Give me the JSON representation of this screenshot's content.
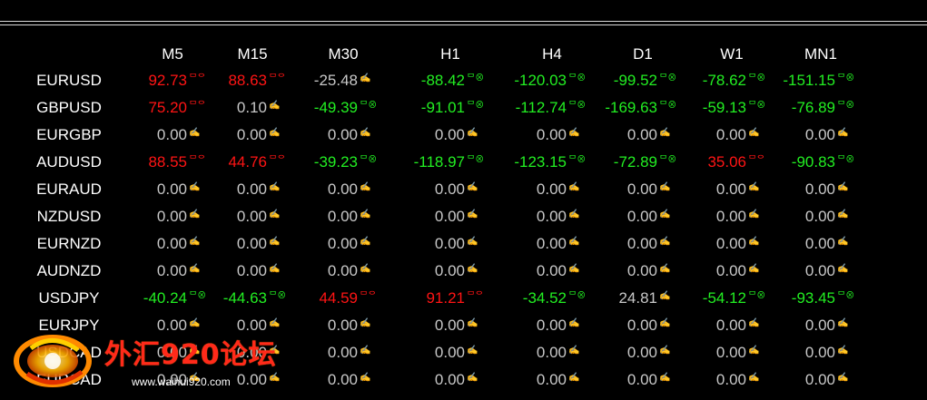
{
  "timeframes": [
    "M5",
    "M15",
    "M30",
    "H1",
    "H4",
    "D1",
    "W1",
    "MN1"
  ],
  "colors": {
    "positive": "#ff1414",
    "negative": "#22ee22",
    "neutral": "#c8c8c8",
    "background": "#000000"
  },
  "rows": [
    {
      "symbol": "EURUSD",
      "cells": [
        {
          "value": "92.73",
          "trend": "pos",
          "icon": "ᄆᄋ"
        },
        {
          "value": "88.63",
          "trend": "pos",
          "icon": "ᄆᄋ"
        },
        {
          "value": "-25.48",
          "trend": "neu",
          "icon": "✍"
        },
        {
          "value": "-88.42",
          "trend": "neg",
          "icon": "ᄆ⊗"
        },
        {
          "value": "-120.03",
          "trend": "neg",
          "icon": "ᄆ⊗"
        },
        {
          "value": "-99.52",
          "trend": "neg",
          "icon": "ᄆ⊗"
        },
        {
          "value": "-78.62",
          "trend": "neg",
          "icon": "ᄆ⊗"
        },
        {
          "value": "-151.15",
          "trend": "neg",
          "icon": "ᄆ⊗"
        }
      ]
    },
    {
      "symbol": "GBPUSD",
      "cells": [
        {
          "value": "75.20",
          "trend": "pos",
          "icon": "ᄆᄋ"
        },
        {
          "value": "0.10",
          "trend": "neu",
          "icon": "✍"
        },
        {
          "value": "-49.39",
          "trend": "neg",
          "icon": "ᄆ⊗"
        },
        {
          "value": "-91.01",
          "trend": "neg",
          "icon": "ᄆ⊗"
        },
        {
          "value": "-112.74",
          "trend": "neg",
          "icon": "ᄆ⊗"
        },
        {
          "value": "-169.63",
          "trend": "neg",
          "icon": "ᄆ⊗"
        },
        {
          "value": "-59.13",
          "trend": "neg",
          "icon": "ᄆ⊗"
        },
        {
          "value": "-76.89",
          "trend": "neg",
          "icon": "ᄆ⊗"
        }
      ]
    },
    {
      "symbol": "EURGBP",
      "cells": [
        {
          "value": "0.00",
          "trend": "neu",
          "icon": "✍"
        },
        {
          "value": "0.00",
          "trend": "neu",
          "icon": "✍"
        },
        {
          "value": "0.00",
          "trend": "neu",
          "icon": "✍"
        },
        {
          "value": "0.00",
          "trend": "neu",
          "icon": "✍"
        },
        {
          "value": "0.00",
          "trend": "neu",
          "icon": "✍"
        },
        {
          "value": "0.00",
          "trend": "neu",
          "icon": "✍"
        },
        {
          "value": "0.00",
          "trend": "neu",
          "icon": "✍"
        },
        {
          "value": "0.00",
          "trend": "neu",
          "icon": "✍"
        }
      ]
    },
    {
      "symbol": "AUDUSD",
      "cells": [
        {
          "value": "88.55",
          "trend": "pos",
          "icon": "ᄆᄋ"
        },
        {
          "value": "44.76",
          "trend": "pos",
          "icon": "ᄆᄋ"
        },
        {
          "value": "-39.23",
          "trend": "neg",
          "icon": "ᄆ⊗"
        },
        {
          "value": "-118.97",
          "trend": "neg",
          "icon": "ᄆ⊗"
        },
        {
          "value": "-123.15",
          "trend": "neg",
          "icon": "ᄆ⊗"
        },
        {
          "value": "-72.89",
          "trend": "neg",
          "icon": "ᄆ⊗"
        },
        {
          "value": "35.06",
          "trend": "pos",
          "icon": "ᄆᄋ"
        },
        {
          "value": "-90.83",
          "trend": "neg",
          "icon": "ᄆ⊗"
        }
      ]
    },
    {
      "symbol": "EURAUD",
      "cells": [
        {
          "value": "0.00",
          "trend": "neu",
          "icon": "✍"
        },
        {
          "value": "0.00",
          "trend": "neu",
          "icon": "✍"
        },
        {
          "value": "0.00",
          "trend": "neu",
          "icon": "✍"
        },
        {
          "value": "0.00",
          "trend": "neu",
          "icon": "✍"
        },
        {
          "value": "0.00",
          "trend": "neu",
          "icon": "✍"
        },
        {
          "value": "0.00",
          "trend": "neu",
          "icon": "✍"
        },
        {
          "value": "0.00",
          "trend": "neu",
          "icon": "✍"
        },
        {
          "value": "0.00",
          "trend": "neu",
          "icon": "✍"
        }
      ]
    },
    {
      "symbol": "NZDUSD",
      "cells": [
        {
          "value": "0.00",
          "trend": "neu",
          "icon": "✍"
        },
        {
          "value": "0.00",
          "trend": "neu",
          "icon": "✍"
        },
        {
          "value": "0.00",
          "trend": "neu",
          "icon": "✍"
        },
        {
          "value": "0.00",
          "trend": "neu",
          "icon": "✍"
        },
        {
          "value": "0.00",
          "trend": "neu",
          "icon": "✍"
        },
        {
          "value": "0.00",
          "trend": "neu",
          "icon": "✍"
        },
        {
          "value": "0.00",
          "trend": "neu",
          "icon": "✍"
        },
        {
          "value": "0.00",
          "trend": "neu",
          "icon": "✍"
        }
      ]
    },
    {
      "symbol": "EURNZD",
      "cells": [
        {
          "value": "0.00",
          "trend": "neu",
          "icon": "✍"
        },
        {
          "value": "0.00",
          "trend": "neu",
          "icon": "✍"
        },
        {
          "value": "0.00",
          "trend": "neu",
          "icon": "✍"
        },
        {
          "value": "0.00",
          "trend": "neu",
          "icon": "✍"
        },
        {
          "value": "0.00",
          "trend": "neu",
          "icon": "✍"
        },
        {
          "value": "0.00",
          "trend": "neu",
          "icon": "✍"
        },
        {
          "value": "0.00",
          "trend": "neu",
          "icon": "✍"
        },
        {
          "value": "0.00",
          "trend": "neu",
          "icon": "✍"
        }
      ]
    },
    {
      "symbol": "AUDNZD",
      "cells": [
        {
          "value": "0.00",
          "trend": "neu",
          "icon": "✍"
        },
        {
          "value": "0.00",
          "trend": "neu",
          "icon": "✍"
        },
        {
          "value": "0.00",
          "trend": "neu",
          "icon": "✍"
        },
        {
          "value": "0.00",
          "trend": "neu",
          "icon": "✍"
        },
        {
          "value": "0.00",
          "trend": "neu",
          "icon": "✍"
        },
        {
          "value": "0.00",
          "trend": "neu",
          "icon": "✍"
        },
        {
          "value": "0.00",
          "trend": "neu",
          "icon": "✍"
        },
        {
          "value": "0.00",
          "trend": "neu",
          "icon": "✍"
        }
      ]
    },
    {
      "symbol": "USDJPY",
      "cells": [
        {
          "value": "-40.24",
          "trend": "neg",
          "icon": "ᄆ⊗"
        },
        {
          "value": "-44.63",
          "trend": "neg",
          "icon": "ᄆ⊗"
        },
        {
          "value": "44.59",
          "trend": "pos",
          "icon": "ᄆᄋ"
        },
        {
          "value": "91.21",
          "trend": "pos",
          "icon": "ᄆᄋ"
        },
        {
          "value": "-34.52",
          "trend": "neg",
          "icon": "ᄆ⊗"
        },
        {
          "value": "24.81",
          "trend": "neu",
          "icon": "✍"
        },
        {
          "value": "-54.12",
          "trend": "neg",
          "icon": "ᄆ⊗"
        },
        {
          "value": "-93.45",
          "trend": "neg",
          "icon": "ᄆ⊗"
        }
      ]
    },
    {
      "symbol": "EURJPY",
      "cells": [
        {
          "value": "0.00",
          "trend": "neu",
          "icon": "✍"
        },
        {
          "value": "0.00",
          "trend": "neu",
          "icon": "✍"
        },
        {
          "value": "0.00",
          "trend": "neu",
          "icon": "✍"
        },
        {
          "value": "0.00",
          "trend": "neu",
          "icon": "✍"
        },
        {
          "value": "0.00",
          "trend": "neu",
          "icon": "✍"
        },
        {
          "value": "0.00",
          "trend": "neu",
          "icon": "✍"
        },
        {
          "value": "0.00",
          "trend": "neu",
          "icon": "✍"
        },
        {
          "value": "0.00",
          "trend": "neu",
          "icon": "✍"
        }
      ]
    },
    {
      "symbol": "USDCAD",
      "cells": [
        {
          "value": "0.00",
          "trend": "neu",
          "icon": "✍"
        },
        {
          "value": "0.00",
          "trend": "neu",
          "icon": "✍"
        },
        {
          "value": "0.00",
          "trend": "neu",
          "icon": "✍"
        },
        {
          "value": "0.00",
          "trend": "neu",
          "icon": "✍"
        },
        {
          "value": "0.00",
          "trend": "neu",
          "icon": "✍"
        },
        {
          "value": "0.00",
          "trend": "neu",
          "icon": "✍"
        },
        {
          "value": "0.00",
          "trend": "neu",
          "icon": "✍"
        },
        {
          "value": "0.00",
          "trend": "neu",
          "icon": "✍"
        }
      ]
    },
    {
      "symbol": "EURCAD",
      "cells": [
        {
          "value": "0.00",
          "trend": "neu",
          "icon": "✍"
        },
        {
          "value": "0.00",
          "trend": "neu",
          "icon": "✍"
        },
        {
          "value": "0.00",
          "trend": "neu",
          "icon": "✍"
        },
        {
          "value": "0.00",
          "trend": "neu",
          "icon": "✍"
        },
        {
          "value": "0.00",
          "trend": "neu",
          "icon": "✍"
        },
        {
          "value": "0.00",
          "trend": "neu",
          "icon": "✍"
        },
        {
          "value": "0.00",
          "trend": "neu",
          "icon": "✍"
        },
        {
          "value": "0.00",
          "trend": "neu",
          "icon": "✍"
        }
      ]
    }
  ],
  "watermark": {
    "text": "外汇920论坛",
    "url": "www.waihui920.com"
  }
}
